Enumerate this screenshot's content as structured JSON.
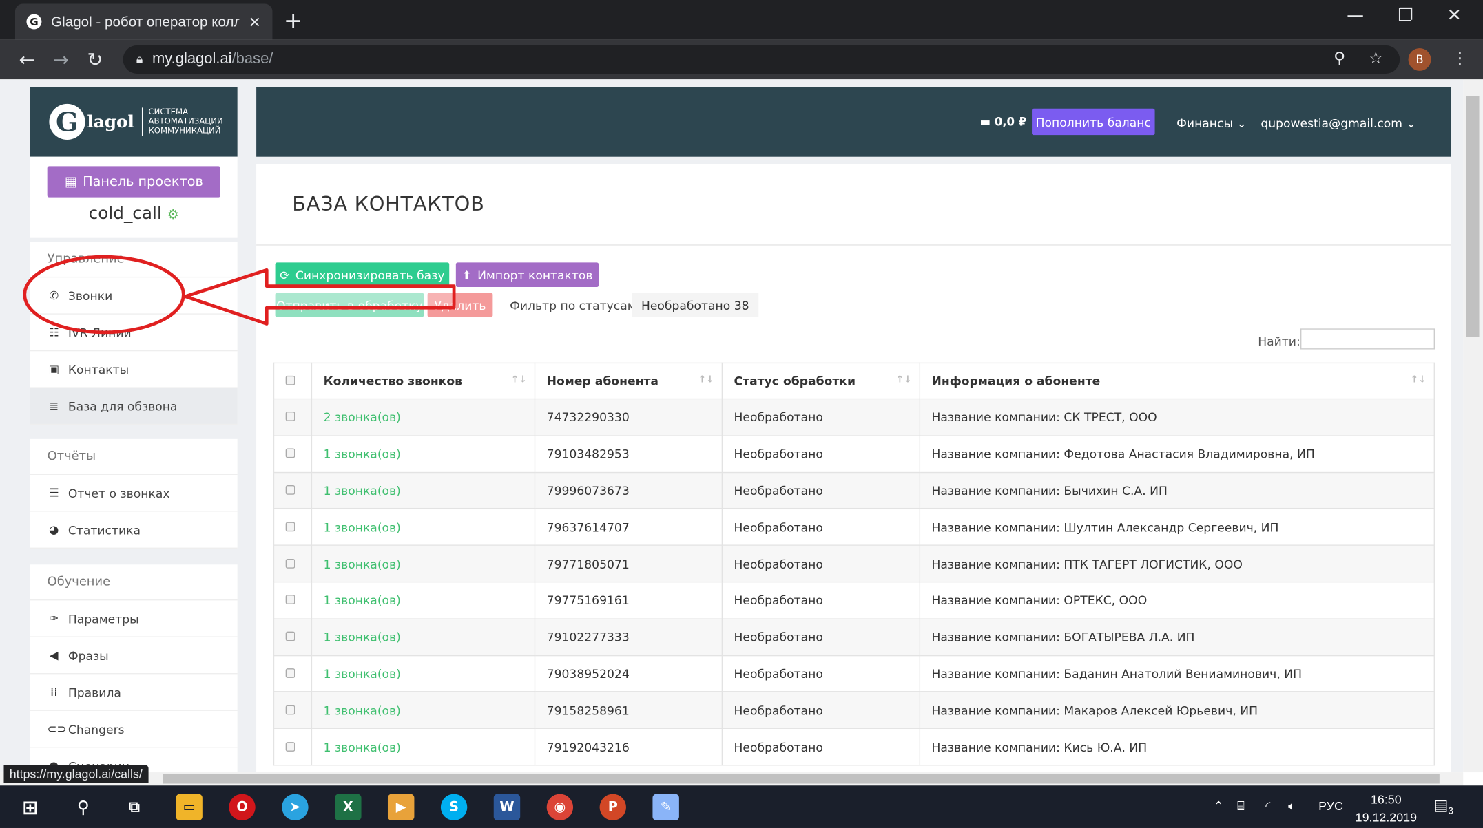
{
  "browser": {
    "tab_title": "Glagol - робот оператор колл-ц",
    "tab_close": "✕",
    "new_tab": "+",
    "url_host": "my.glagol.ai",
    "url_path": "/base/",
    "profile_initial": "B",
    "status_url": "https://my.glagol.ai/calls/"
  },
  "logo": {
    "letter": "G",
    "word": "lagol",
    "subtitle_1": "система",
    "subtitle_2": "автоматизации",
    "subtitle_3": "коммуникаций"
  },
  "sidebar": {
    "projects_button": "Панель проектов",
    "project_name": "cold_call",
    "section_manage": "Управление",
    "manage_items": [
      "Звонки",
      "IVR Линии",
      "Контакты",
      "База для обзвона"
    ],
    "section_reports": "Отчёты",
    "report_items": [
      "Отчет о звонках",
      "Статистика"
    ],
    "section_training": "Обучение",
    "training_items": [
      "Параметры",
      "Фразы",
      "Правила",
      "Changers",
      "Сценарии"
    ]
  },
  "header": {
    "balance": "0,0 ₽",
    "topup_button": "Пополнить баланс",
    "finance_menu": "Финансы",
    "user_menu": "qupowestia@gmail.com"
  },
  "main": {
    "title": "БАЗА КОНТАКТОВ",
    "sync_button": "Синхронизировать базу",
    "import_button": "Импорт контактов",
    "send_button": "Отправить в обработку",
    "delete_button": "Удалить",
    "filter_label": "Фильтр по статусам:",
    "filter_value": "Необработано 38",
    "search_label": "Найти:",
    "search_value": "",
    "columns": [
      "Количество звонков",
      "Номер абонента",
      "Статус обработки",
      "Информация о абоненте"
    ],
    "rows": [
      {
        "calls": "2 звонка(ов)",
        "number": "74732290330",
        "status": "Необработано",
        "info": "Название компании: СК ТРЕСТ, ООО"
      },
      {
        "calls": "1 звонка(ов)",
        "number": "79103482953",
        "status": "Необработано",
        "info": "Название компании: Федотова Анастасия Владимировна, ИП"
      },
      {
        "calls": "1 звонка(ов)",
        "number": "79996073673",
        "status": "Необработано",
        "info": "Название компании: Бычихин С.А. ИП"
      },
      {
        "calls": "1 звонка(ов)",
        "number": "79637614707",
        "status": "Необработано",
        "info": "Название компании: Шултин Александр Сергеевич, ИП"
      },
      {
        "calls": "1 звонка(ов)",
        "number": "79771805071",
        "status": "Необработано",
        "info": "Название компании: ПТК ТАГЕРТ ЛОГИСТИК, ООО"
      },
      {
        "calls": "1 звонка(ов)",
        "number": "79775169161",
        "status": "Необработано",
        "info": "Название компании: ОРТЕКС, ООО"
      },
      {
        "calls": "1 звонка(ов)",
        "number": "79102277333",
        "status": "Необработано",
        "info": "Название компании: БОГАТЫРЕВА Л.А. ИП"
      },
      {
        "calls": "1 звонка(ов)",
        "number": "79038952024",
        "status": "Необработано",
        "info": "Название компании: Баданин Анатолий Вениаминович, ИП"
      },
      {
        "calls": "1 звонка(ов)",
        "number": "79158258961",
        "status": "Необработано",
        "info": "Название компании: Макаров Алексей Юрьевич, ИП"
      },
      {
        "calls": "1 звонка(ов)",
        "number": "79192043216",
        "status": "Необработано",
        "info": "Название компании: Кись Ю.А. ИП"
      }
    ]
  },
  "taskbar": {
    "lang": "РУС",
    "time": "16:50",
    "date": "19.12.2019",
    "notifications": "3"
  },
  "colors": {
    "header_bg": "#2d4650",
    "accent_purple": "#a36cc6",
    "topup_blue": "#7b5cf0",
    "sync_green": "#2ecc8f",
    "delete_red": "#f49a9a",
    "annotation_red": "#e02020"
  }
}
